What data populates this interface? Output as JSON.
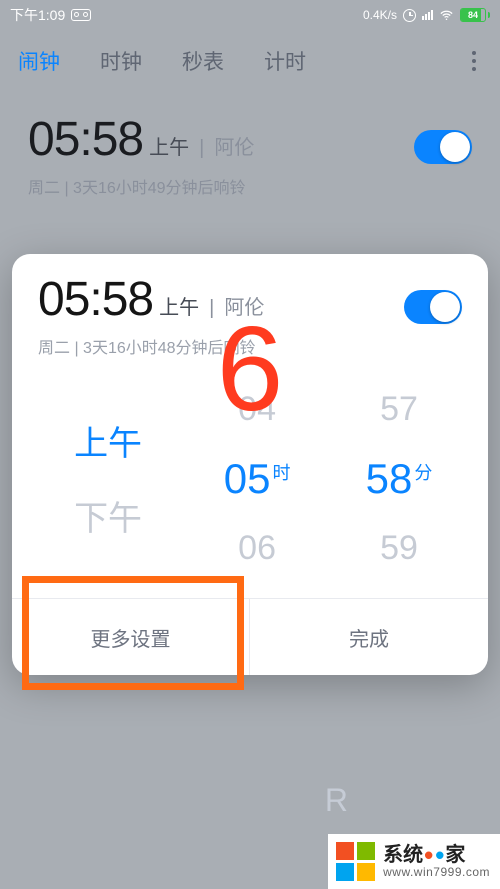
{
  "status": {
    "time": "下午1:09",
    "speed": "0.4K/s",
    "battery_pct": "84"
  },
  "tabs": {
    "alarm": "闹钟",
    "clock": "时钟",
    "stopwatch": "秒表",
    "timer": "计时"
  },
  "bg_alarm": {
    "time": "05:58",
    "ampm": "上午",
    "sep": "|",
    "label": "阿伦",
    "sub": "周二  |  3天16小时49分钟后响铃"
  },
  "modal_alarm": {
    "time": "05:58",
    "ampm": "上午",
    "sep": "|",
    "label": "阿伦",
    "sub": "周二  |  3天16小时48分钟后响铃"
  },
  "picker": {
    "ampm_prev": "",
    "ampm_sel": "上午",
    "ampm_next": "下午",
    "hour_prev": "04",
    "hour_sel": "05",
    "hour_unit": "时",
    "hour_next": "06",
    "min_prev": "57",
    "min_sel": "58",
    "min_unit": "分",
    "min_next": "59"
  },
  "actions": {
    "more": "更多设置",
    "done": "完成"
  },
  "overlay": {
    "step_number": "6"
  },
  "watermark": {
    "main_a": "系统",
    "main_b": "家",
    "sub": "www.win7999.com"
  }
}
